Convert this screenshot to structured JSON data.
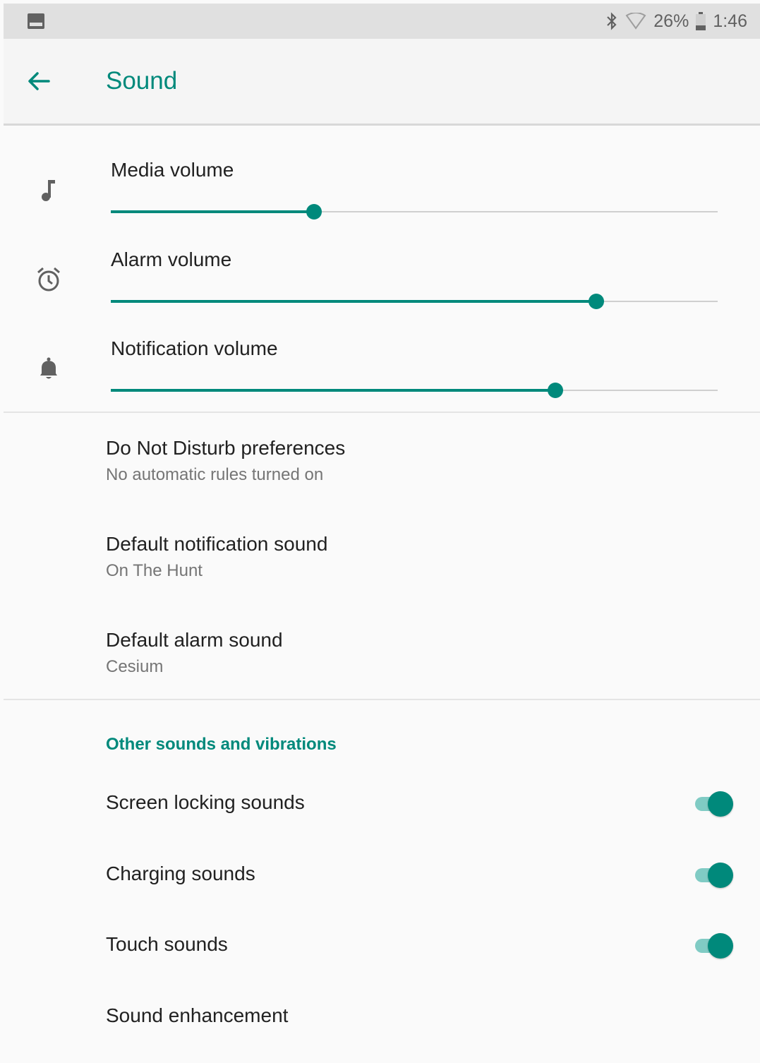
{
  "status_bar": {
    "battery": "26%",
    "time": "1:46"
  },
  "app_bar": {
    "title": "Sound"
  },
  "volumes": [
    {
      "label": "Media volume",
      "icon": "music-note-icon",
      "level": 0.335
    },
    {
      "label": "Alarm volume",
      "icon": "alarm-clock-icon",
      "level": 0.8
    },
    {
      "label": "Notification volume",
      "icon": "bell-icon",
      "level": 0.732
    }
  ],
  "preferences": [
    {
      "title": "Do Not Disturb preferences",
      "subtitle": "No automatic rules turned on"
    },
    {
      "title": "Default notification sound",
      "subtitle": "On The Hunt"
    },
    {
      "title": "Default alarm sound",
      "subtitle": "Cesium"
    }
  ],
  "other_section": {
    "header": "Other sounds and vibrations",
    "toggles": [
      {
        "label": "Screen locking sounds",
        "on": true
      },
      {
        "label": "Charging sounds",
        "on": true
      },
      {
        "label": "Touch sounds",
        "on": true
      }
    ],
    "sound_enhancement": "Sound enhancement"
  },
  "colors": {
    "accent": "#00897b",
    "accent_light": "#80cbc4",
    "status_bar": "#e0e0e0",
    "background": "#fafafa"
  }
}
